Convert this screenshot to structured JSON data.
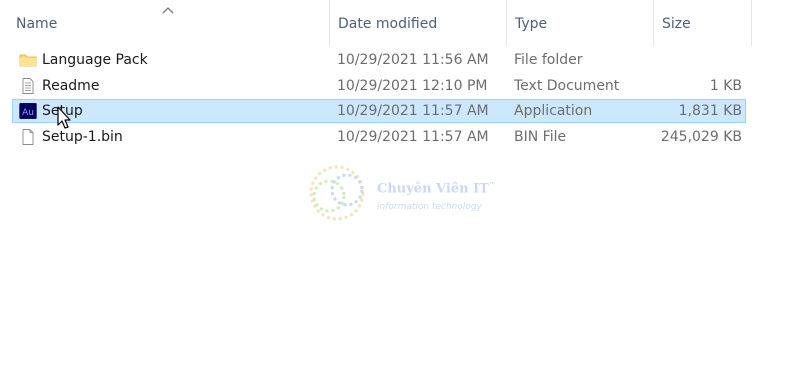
{
  "columns": {
    "name": "Name",
    "date": "Date modified",
    "type": "Type",
    "size": "Size",
    "sort_column": "Name",
    "sort_direction": "ascending"
  },
  "files": [
    {
      "name": "Language Pack",
      "date": "10/29/2021 11:56 AM",
      "type": "File folder",
      "size": "",
      "icon": "folder-icon",
      "selected": false
    },
    {
      "name": "Readme",
      "date": "10/29/2021 12:10 PM",
      "type": "Text Document",
      "size": "1 KB",
      "icon": "text-document-icon",
      "selected": false
    },
    {
      "name": "Setup",
      "date": "10/29/2021 11:57 AM",
      "type": "Application",
      "size": "1,831 KB",
      "icon": "audition-app-icon",
      "selected": true
    },
    {
      "name": "Setup-1.bin",
      "date": "10/29/2021 11:57 AM",
      "type": "BIN File",
      "size": "245,029 KB",
      "icon": "blank-file-icon",
      "selected": false
    }
  ],
  "watermark": {
    "title": "Chuyên Viên IT",
    "trademark": "™",
    "subtitle": "information technology"
  },
  "colors": {
    "selection_bg": "#cce8ff",
    "selection_border": "#99d1ff",
    "header_text": "#4c607a",
    "folder": "#f8d775",
    "audition_bg": "#00005b",
    "audition_fg": "#9999ff"
  }
}
